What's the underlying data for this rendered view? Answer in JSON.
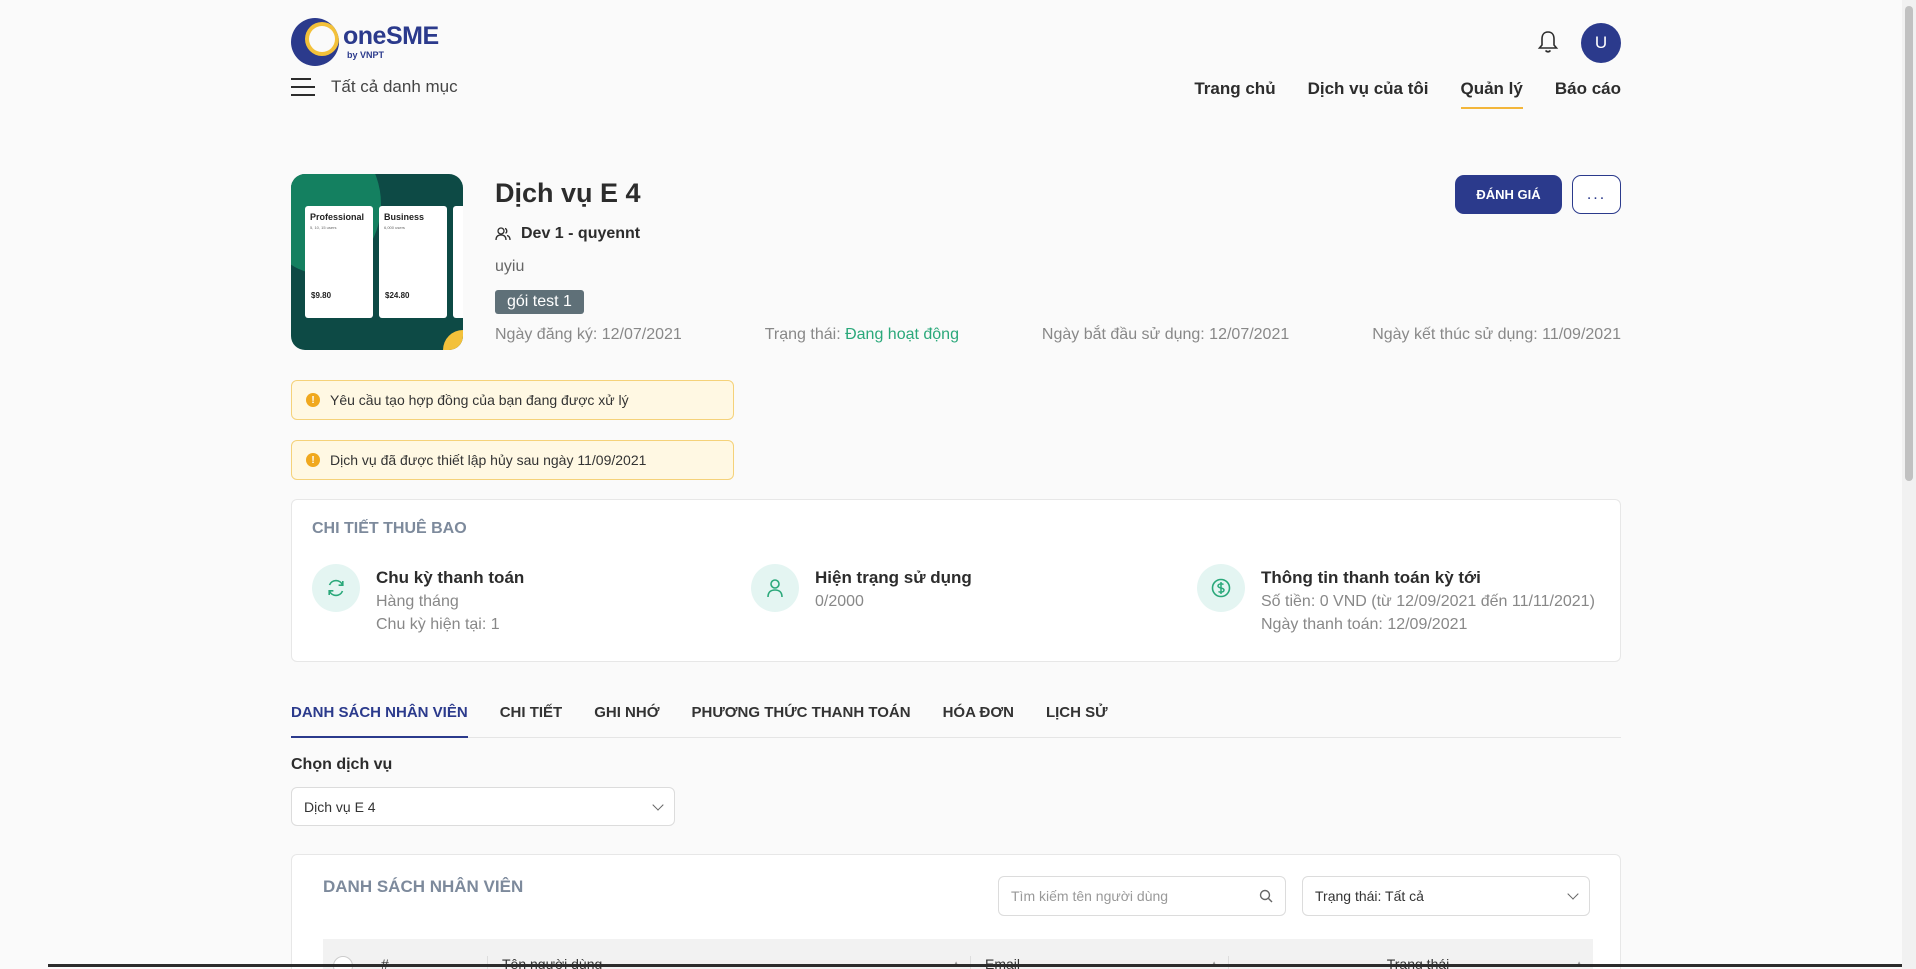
{
  "header": {
    "brand": "oneSME",
    "brand_sub": "by VNPT",
    "menu_label": "Tất cả danh mục",
    "avatar_initial": "U",
    "nav": [
      {
        "label": "Trang chủ",
        "active": false
      },
      {
        "label": "Dịch vụ của tôi",
        "active": false
      },
      {
        "label": "Quản lý",
        "active": true
      },
      {
        "label": "Báo cáo",
        "active": false
      }
    ]
  },
  "service": {
    "title": "Dịch vụ E 4",
    "owner": "Dev 1 - quyennt",
    "description": "uyiu",
    "tag": "gói test 1",
    "image_cards": [
      {
        "name": "Professional",
        "sub": "5, 10, 15 users",
        "price": "$9.80"
      },
      {
        "name": "Business",
        "sub": "6,000 users",
        "price": "$24.80"
      }
    ],
    "registration_date_label": "Ngày đăng ký: 12/07/2021",
    "status_prefix": "Trạng thái: ",
    "status_value": "Đang hoạt động",
    "start_date_label": "Ngày bắt đầu sử dụng: 12/07/2021",
    "end_date_label": "Ngày kết thúc sử dụng: 11/09/2021",
    "rate_button": "ĐÁNH GIÁ",
    "more_button": "..."
  },
  "alerts": [
    "Yêu cầu tạo hợp đồng của bạn đang được xử lý",
    "Dịch vụ đã được thiết lập hủy sau ngày 11/09/2021"
  ],
  "subscription": {
    "title": "CHI TIẾT THUÊ BAO",
    "items": [
      {
        "title": "Chu kỳ thanh toán",
        "line1": "Hàng tháng",
        "line2": "Chu kỳ hiện tại: 1",
        "icon": "refresh-icon"
      },
      {
        "title": "Hiện trạng sử dụng",
        "line1": "0/2000",
        "line2": "",
        "icon": "user-icon"
      },
      {
        "title": "Thông tin thanh toán kỳ tới",
        "line1": "Số tiền: 0 VND (từ 12/09/2021 đến 11/11/2021)",
        "line2": "Ngày thanh toán: 12/09/2021",
        "icon": "dollar-icon"
      }
    ]
  },
  "tabs": [
    {
      "label": "DANH SÁCH NHÂN VIÊN",
      "active": true
    },
    {
      "label": "CHI TIẾT",
      "active": false
    },
    {
      "label": "GHI NHỚ",
      "active": false
    },
    {
      "label": "PHƯƠNG THỨC THANH TOÁN",
      "active": false
    },
    {
      "label": "HÓA ĐƠN",
      "active": false
    },
    {
      "label": "LỊCH SỬ",
      "active": false
    }
  ],
  "service_select": {
    "label": "Chọn dịch vụ",
    "value": "Dịch vụ E 4"
  },
  "employees": {
    "title": "DANH SÁCH NHÂN VIÊN",
    "search_placeholder": "Tìm kiếm tên người dùng",
    "status_filter": "Trạng thái: Tất cả",
    "columns": [
      "#",
      "Tên người dùng",
      "Email",
      "Trạng thái"
    ]
  },
  "colors": {
    "primary": "#2b3a8c",
    "accent": "#f3b63a",
    "status_active": "#2aa87a"
  }
}
